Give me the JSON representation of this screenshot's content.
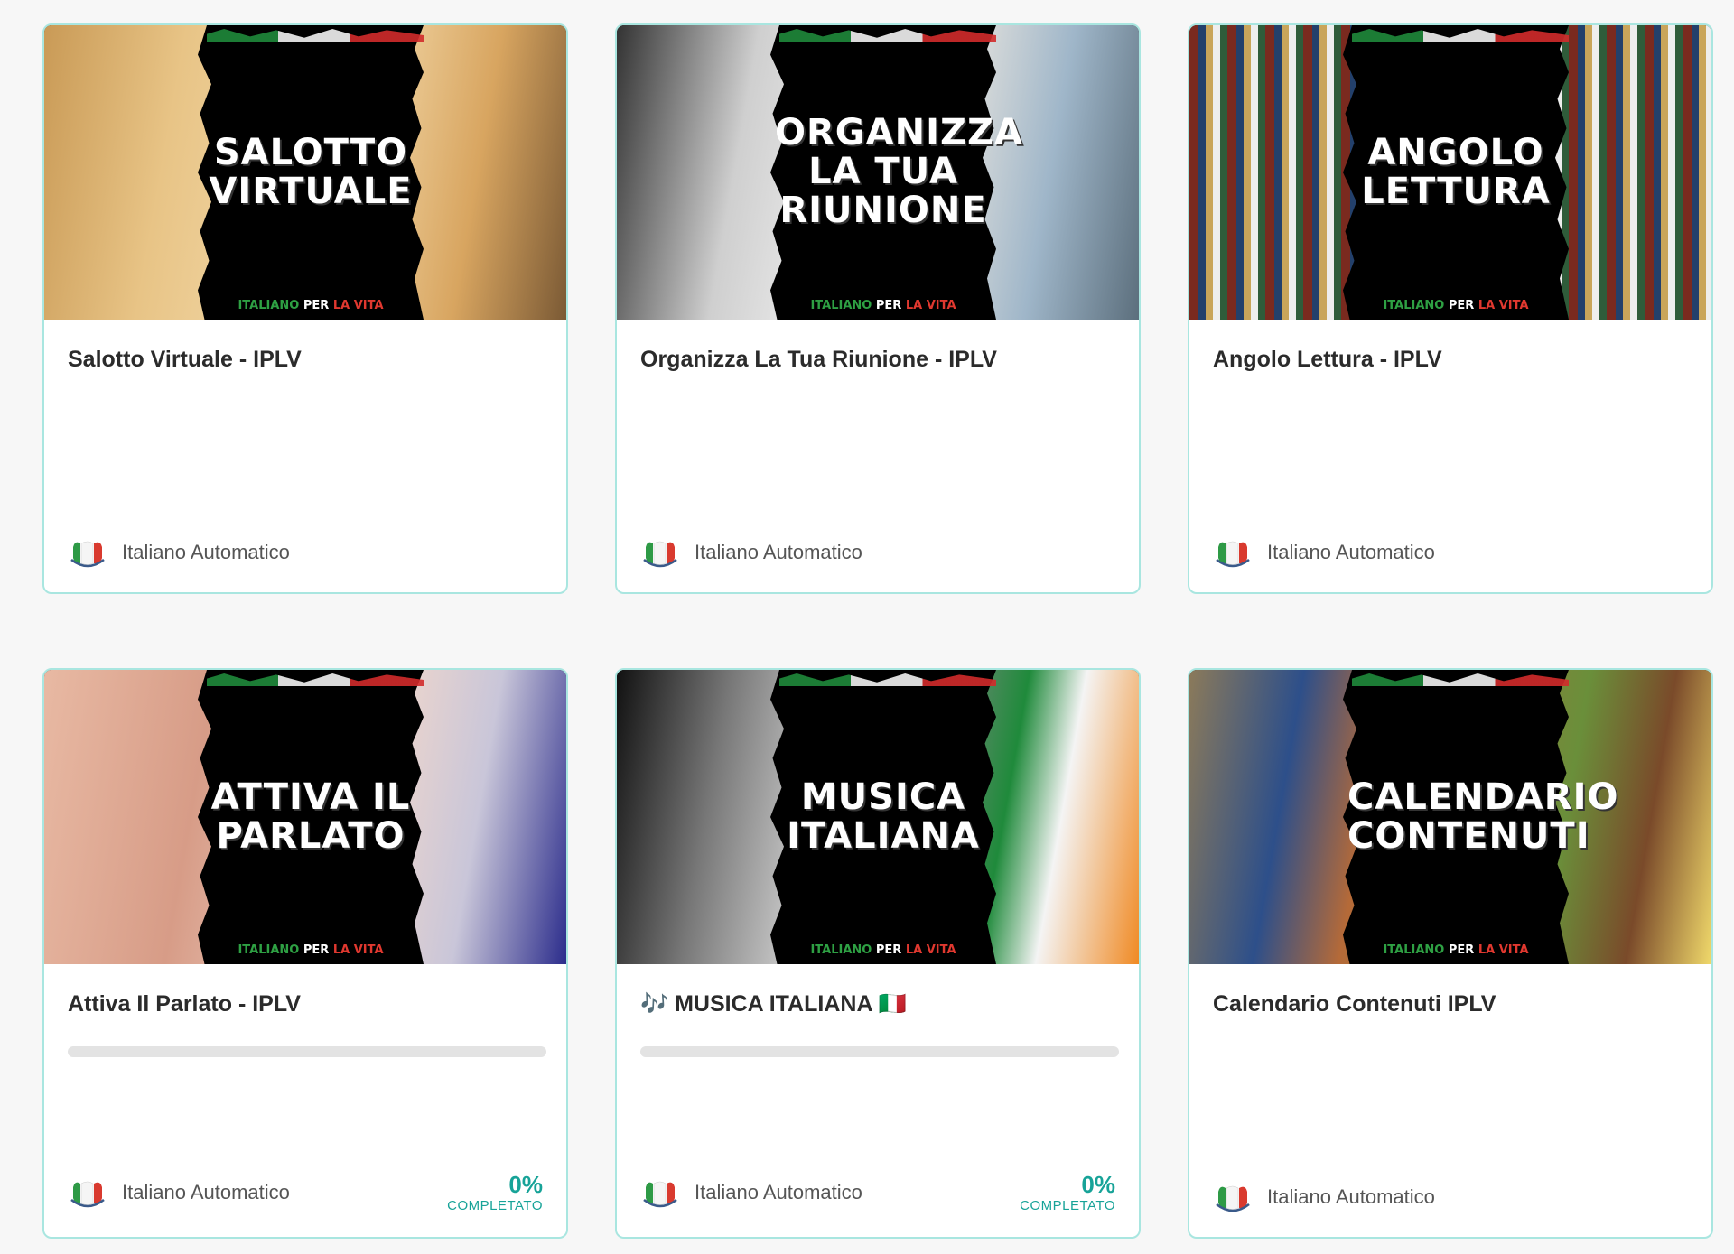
{
  "brand": {
    "part1": "ITALIANO",
    "part2": "PER",
    "part3": "LA VITA"
  },
  "author": "Italiano Automatico",
  "progress_label": "COMPLETATO",
  "accent": "#17a398",
  "border": "#a9e6e0",
  "cards": [
    {
      "art": "SALOTTO\nVIRTUALE",
      "title": "Salotto Virtuale - IPLV",
      "theme": "living-room",
      "progress": null
    },
    {
      "art": "ORGANIZZA\nLA TUA\nRIUNIONE",
      "title": "Organizza La Tua Riunione - IPLV",
      "theme": "agenda",
      "progress": null
    },
    {
      "art": "ANGOLO\nLETTURA",
      "title": "Angolo Lettura - IPLV",
      "theme": "library",
      "progress": null
    },
    {
      "art": "ATTIVA IL\nPARLATO",
      "title": "Attiva Il Parlato - IPLV",
      "theme": "speaking",
      "progress": {
        "value": "0%",
        "fraction": 0
      }
    },
    {
      "art": "MUSICA\nITALIANA",
      "title": "🎶 MUSICA ITALIANA 🇮🇹",
      "theme": "music",
      "progress": {
        "value": "0%",
        "fraction": 0
      }
    },
    {
      "art": "CALENDARIO\nCONTENUTI",
      "title": "Calendario Contenuti IPLV",
      "theme": "collage",
      "progress": null
    }
  ]
}
